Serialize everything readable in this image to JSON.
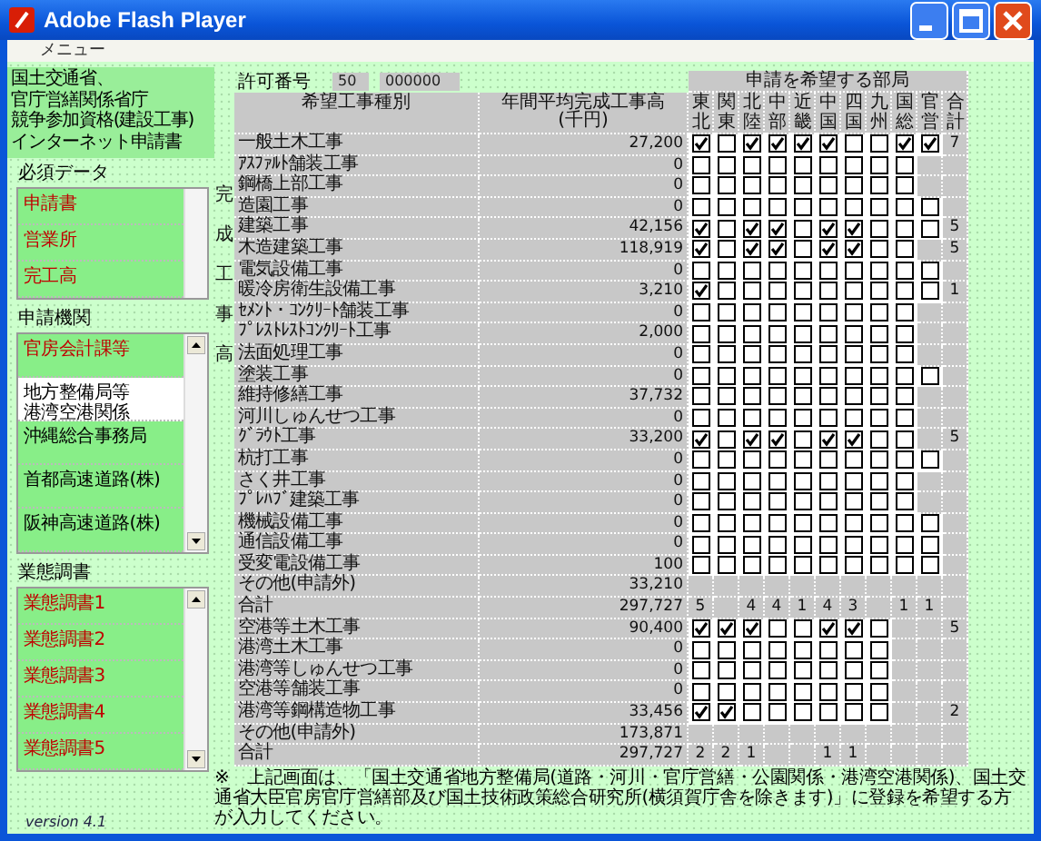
{
  "window": {
    "title": "Adobe Flash Player"
  },
  "menu": [
    "メニュー"
  ],
  "sidebar": {
    "heading_lines": [
      "国土交通省、",
      "官庁営繕関係省庁",
      "競争参加資格(建設工事)",
      "インターネット申請書"
    ],
    "sections": [
      {
        "title": "必須データ",
        "scroll_arrows": false,
        "items": [
          {
            "lines": [
              "申請書"
            ],
            "filled": true,
            "alert": true
          },
          {
            "lines": [
              "営業所"
            ],
            "filled": true,
            "alert": true
          },
          {
            "lines": [
              "完工高"
            ],
            "filled": true,
            "alert": true
          }
        ]
      },
      {
        "title": "申請機関",
        "scroll_arrows": true,
        "items": [
          {
            "lines": [
              "官房会計課等"
            ],
            "filled": true,
            "alert": true
          },
          {
            "lines": [
              "地方整備局等",
              "港湾空港関係"
            ],
            "filled": false,
            "alert": false
          },
          {
            "lines": [
              "沖縄総合事務局"
            ],
            "filled": true,
            "alert": false
          },
          {
            "lines": [
              "首都高速道路(株)"
            ],
            "filled": true,
            "alert": false
          },
          {
            "lines": [
              "阪神高速道路(株)"
            ],
            "filled": true,
            "alert": false
          }
        ]
      },
      {
        "title": "業態調書",
        "scroll_arrows": true,
        "items": [
          {
            "lines": [
              "業態調書1"
            ],
            "filled": true,
            "alert": true
          },
          {
            "lines": [
              "業態調書2"
            ],
            "filled": true,
            "alert": true
          },
          {
            "lines": [
              "業態調書3"
            ],
            "filled": true,
            "alert": true
          },
          {
            "lines": [
              "業態調書4"
            ],
            "filled": true,
            "alert": true
          },
          {
            "lines": [
              "業態調書5"
            ],
            "filled": true,
            "alert": true
          }
        ]
      }
    ],
    "version": "version 4.1"
  },
  "permit": {
    "label": "許可番号",
    "values": [
      "50",
      "000000"
    ]
  },
  "table": {
    "group_header": "申請を希望する部局",
    "columns": [
      "希望工事種別",
      "年間平均完成工事高\n(千円)"
    ],
    "offices": [
      "東北",
      "関東",
      "北陸",
      "中部",
      "近畿",
      "中国",
      "四国",
      "九州",
      "国総",
      "官営"
    ],
    "total_header": "合計",
    "sections": [
      {
        "side_label": "完成工事高",
        "rows": [
          {
            "kind": "entry",
            "name": "一般土木工事",
            "amount": "27,200",
            "boxes": [
              true,
              false,
              true,
              true,
              true,
              true,
              false,
              false,
              true,
              true
            ],
            "total": "7"
          },
          {
            "kind": "entry",
            "name": "ｱｽﾌｧﾙﾄ舗装工事",
            "amount": "0",
            "boxes": [
              false,
              false,
              false,
              false,
              false,
              false,
              false,
              false,
              false
            ]
          },
          {
            "kind": "entry",
            "name": "鋼橋上部工事",
            "amount": "0",
            "boxes": [
              false,
              false,
              false,
              false,
              false,
              false,
              false,
              false,
              false
            ]
          },
          {
            "kind": "entry",
            "name": "造園工事",
            "amount": "0",
            "boxes": [
              false,
              false,
              false,
              false,
              false,
              false,
              false,
              false,
              false,
              false
            ]
          },
          {
            "kind": "entry",
            "name": "建築工事",
            "amount": "42,156",
            "boxes": [
              true,
              false,
              true,
              true,
              false,
              true,
              true,
              false,
              false,
              false
            ],
            "total": "5"
          },
          {
            "kind": "entry",
            "name": "木造建築工事",
            "amount": "118,919",
            "boxes": [
              true,
              false,
              true,
              true,
              false,
              true,
              true,
              false,
              false
            ],
            "total": "5"
          },
          {
            "kind": "entry",
            "name": "電気設備工事",
            "amount": "0",
            "boxes": [
              false,
              false,
              false,
              false,
              false,
              false,
              false,
              false,
              false,
              false
            ]
          },
          {
            "kind": "entry",
            "name": "暖冷房衛生設備工事",
            "amount": "3,210",
            "boxes": [
              true,
              false,
              false,
              false,
              false,
              false,
              false,
              false,
              false,
              false
            ],
            "total": "1"
          },
          {
            "kind": "entry",
            "name": "ｾﾒﾝﾄ・ｺﾝｸﾘｰﾄ舗装工事",
            "amount": "0",
            "boxes": [
              false,
              false,
              false,
              false,
              false,
              false,
              false,
              false,
              false
            ]
          },
          {
            "kind": "entry",
            "name": "ﾌﾟﾚｽﾄﾚｽﾄｺﾝｸﾘｰﾄ工事",
            "amount": "2,000",
            "boxes": [
              false,
              false,
              false,
              false,
              false,
              false,
              false,
              false,
              false
            ]
          },
          {
            "kind": "entry",
            "name": "法面処理工事",
            "amount": "0",
            "boxes": [
              false,
              false,
              false,
              false,
              false,
              false,
              false,
              false,
              false
            ]
          },
          {
            "kind": "entry",
            "name": "塗装工事",
            "amount": "0",
            "boxes": [
              false,
              false,
              false,
              false,
              false,
              false,
              false,
              false,
              false,
              false
            ]
          },
          {
            "kind": "entry",
            "name": "維持修繕工事",
            "amount": "37,732",
            "boxes": [
              false,
              false,
              false,
              false,
              false,
              false,
              false,
              false,
              false
            ]
          },
          {
            "kind": "entry",
            "name": "河川しゅんせつ工事",
            "amount": "0",
            "boxes": [
              false,
              false,
              false,
              false,
              false,
              false,
              false,
              false,
              false
            ]
          },
          {
            "kind": "entry",
            "name": "ｸﾞﾗｳﾄ工事",
            "amount": "33,200",
            "boxes": [
              true,
              false,
              true,
              true,
              false,
              true,
              true,
              false,
              false
            ],
            "total": "5"
          },
          {
            "kind": "entry",
            "name": "杭打工事",
            "amount": "0",
            "boxes": [
              false,
              false,
              false,
              false,
              false,
              false,
              false,
              false,
              false,
              false
            ]
          },
          {
            "kind": "entry",
            "name": "さく井工事",
            "amount": "0",
            "boxes": [
              false,
              false,
              false,
              false,
              false,
              false,
              false,
              false,
              false
            ]
          },
          {
            "kind": "entry",
            "name": "ﾌﾟﾚﾊﾌﾞ建築工事",
            "amount": "0",
            "boxes": [
              false,
              false,
              false,
              false,
              false,
              false,
              false,
              false,
              false
            ]
          },
          {
            "kind": "entry",
            "name": "機械設備工事",
            "amount": "0",
            "boxes": [
              false,
              false,
              false,
              false,
              false,
              false,
              false,
              false,
              false,
              false
            ]
          },
          {
            "kind": "entry",
            "name": "通信設備工事",
            "amount": "0",
            "boxes": [
              false,
              false,
              false,
              false,
              false,
              false,
              false,
              false,
              false,
              false
            ]
          },
          {
            "kind": "entry",
            "name": "受変電設備工事",
            "amount": "100",
            "boxes": [
              false,
              false,
              false,
              false,
              false,
              false,
              false,
              false,
              false,
              false
            ]
          },
          {
            "kind": "entry",
            "name": "その他(申請外)",
            "amount": "33,210",
            "boxes": []
          },
          {
            "kind": "sum",
            "name": "合計",
            "amount": "297,727",
            "counts": [
              {
                "kind": "count",
                "text": "5"
              },
              {
                "kind": "blank"
              },
              {
                "kind": "count",
                "text": "4"
              },
              {
                "kind": "count",
                "text": "4"
              },
              {
                "kind": "count",
                "text": "1"
              },
              {
                "kind": "count",
                "text": "4"
              },
              {
                "kind": "count",
                "text": "3"
              },
              {
                "kind": "blank"
              },
              {
                "kind": "count",
                "text": "1"
              },
              {
                "kind": "count",
                "text": "1"
              }
            ]
          }
        ]
      },
      {
        "rows": [
          {
            "kind": "entry",
            "name": "空港等土木工事",
            "amount": "90,400",
            "boxes": [
              true,
              true,
              true,
              false,
              false,
              true,
              true,
              false
            ],
            "total": "5"
          },
          {
            "kind": "entry",
            "name": "港湾土木工事",
            "amount": "0",
            "boxes": [
              false,
              false,
              false,
              false,
              false,
              false,
              false,
              false
            ]
          },
          {
            "kind": "entry",
            "name": "港湾等しゅんせつ工事",
            "amount": "0",
            "boxes": [
              false,
              false,
              false,
              false,
              false,
              false,
              false,
              false
            ]
          },
          {
            "kind": "entry",
            "name": "空港等舗装工事",
            "amount": "0",
            "boxes": [
              false,
              false,
              false,
              false,
              false,
              false,
              false,
              false
            ]
          },
          {
            "kind": "entry",
            "name": "港湾等鋼構造物工事",
            "amount": "33,456",
            "boxes": [
              true,
              true,
              false,
              false,
              false,
              false,
              false,
              false
            ],
            "total": "2"
          },
          {
            "kind": "entry",
            "name": "その他(申請外)",
            "amount": "173,871",
            "boxes": []
          },
          {
            "kind": "sum",
            "name": "合計",
            "amount": "297,727",
            "counts": [
              {
                "kind": "count",
                "text": "2"
              },
              {
                "kind": "count",
                "text": "2"
              },
              {
                "kind": "count",
                "text": "1"
              },
              {
                "kind": "blank"
              },
              {
                "kind": "blank"
              },
              {
                "kind": "count",
                "text": "1"
              },
              {
                "kind": "count",
                "text": "1"
              }
            ]
          }
        ]
      }
    ]
  },
  "footnote": "※　上記画面は、「国土交通省地方整備局(道路・河川・官庁営繕・公園関係・港湾空港関係)、国土交通省大臣官房官庁営繕部及び国土技術政策総合研究所(横須賀庁舎を除きます)」に登録を希望する方が入力してください。"
}
